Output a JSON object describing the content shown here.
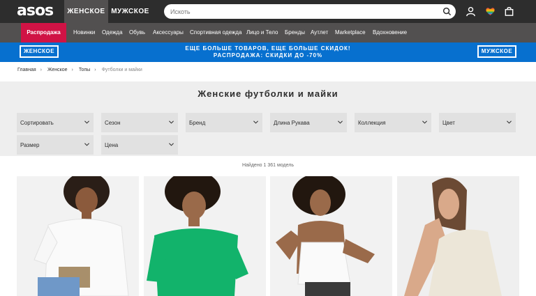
{
  "header": {
    "logo": "asos",
    "gender_tabs": [
      "ЖЕНСКОЕ",
      "МУЖСКОЕ"
    ],
    "search_placeholder": "Искоть"
  },
  "category_nav": {
    "sale": "Распродажа",
    "items": [
      "Новинки",
      "Одежда",
      "Обувь",
      "Аксессуары",
      "Спортивная одежда",
      "Лицо и Тело",
      "Бренды",
      "Аутлет",
      "Marketplace",
      "Вдохновение"
    ]
  },
  "promo": {
    "left_button": "ЖЕНСКОЕ",
    "line1": "ЕЩЕ БОЛЬШЕ ТОВАРОВ, ЕЩЕ БОЛЬШЕ СКИДОК!",
    "line2": "РАСПРОДАЖА: СКИДКИ ДО -70%",
    "right_button": "МУЖСКОЕ"
  },
  "breadcrumb": {
    "items": [
      "Главная",
      "Женское",
      "Топы"
    ],
    "current": "Футболки и майки"
  },
  "page_title": "Женские футболки и майки",
  "filters": [
    "Сортировать",
    "Сезон",
    "Бренд",
    "Длина Рукава",
    "Коллекция",
    "Цвет",
    "Размер",
    "Цена"
  ],
  "result_count": "Найдено 1 361 модель",
  "products": [
    {
      "icon": "white-tshirt-photo"
    },
    {
      "icon": "green-tshirt-photo"
    },
    {
      "icon": "white-camisole-photo"
    },
    {
      "icon": "cream-tank-top-photo"
    }
  ],
  "colors": {
    "topbar": "#2d2d2d",
    "nav": "#525050",
    "sale": "#d01345",
    "promo": "#0770cf",
    "band": "#eeeeee"
  }
}
